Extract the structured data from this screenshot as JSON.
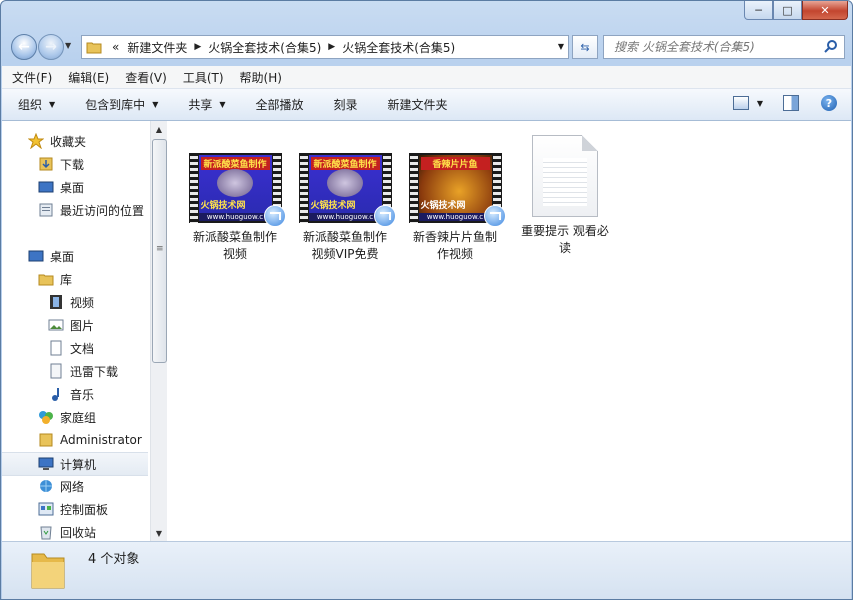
{
  "window": {
    "controls": {
      "minimize": "─",
      "maximize": "□",
      "close": "✕"
    }
  },
  "address": {
    "overflow": "«",
    "crumbs": [
      "新建文件夹",
      "火锅全套技术(合集5)",
      "火锅全套技术(合集5)"
    ]
  },
  "search": {
    "placeholder": "搜索 火锅全套技术(合集5)"
  },
  "menu": [
    "文件(F)",
    "编辑(E)",
    "查看(V)",
    "工具(T)",
    "帮助(H)"
  ],
  "commands": {
    "organize": "组织",
    "include_library": "包含到库中",
    "share": "共享",
    "play_all": "全部播放",
    "burn": "刻录",
    "new_folder": "新建文件夹"
  },
  "nav": {
    "favorites": "收藏夹",
    "downloads": "下载",
    "desktop_fav": "桌面",
    "recent": "最近访问的位置",
    "desktop": "桌面",
    "libraries": "库",
    "videos": "视频",
    "pictures": "图片",
    "documents": "文档",
    "thunder": "迅雷下载",
    "music": "音乐",
    "homegroup": "家庭组",
    "admin": "Administrator",
    "computer": "计算机",
    "network": "网络",
    "control_panel": "控制面板",
    "recycle": "回收站"
  },
  "files": [
    {
      "line1": "新派酸菜鱼制作",
      "line2": "视频",
      "thumb_title": "新派酸菜鱼制作",
      "thumb_sub": "火锅技术网",
      "thumb_url": "www.huoguow.c"
    },
    {
      "line1": "新派酸菜鱼制作",
      "line2": "视频VIP免费",
      "thumb_title": "新派酸菜鱼制作",
      "thumb_sub": "火锅技术网",
      "thumb_url": "www.huoguow.c"
    },
    {
      "line1": "新香辣片片鱼制",
      "line2": "作视频",
      "thumb_title": "香辣片片鱼",
      "thumb_sub": "火锅技术网",
      "thumb_url": "www.huoguow.c"
    },
    {
      "line1": "重要提示 观看必",
      "line2": "读"
    }
  ],
  "status": {
    "count": "4 个对象"
  },
  "colors": {
    "accent": "#2a5ea8",
    "close": "#c3452f",
    "frame_bg": "#d5e2f1"
  }
}
